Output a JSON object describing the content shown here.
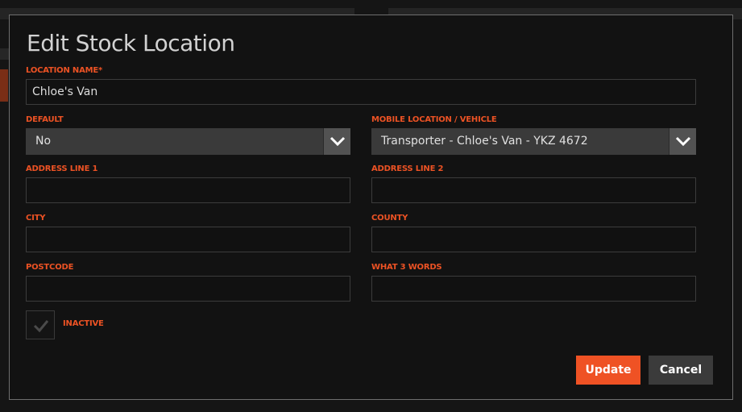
{
  "modal": {
    "title": "Edit Stock Location"
  },
  "fields": {
    "location_name": {
      "label": "LOCATION NAME*",
      "value": "Chloe's Van"
    },
    "default": {
      "label": "DEFAULT",
      "value": "No"
    },
    "mobile_location": {
      "label": "MOBILE LOCATION / VEHICLE",
      "value": "Transporter - Chloe's Van - YKZ 4672"
    },
    "address_line_1": {
      "label": "ADDRESS LINE 1",
      "value": ""
    },
    "address_line_2": {
      "label": "ADDRESS LINE 2",
      "value": ""
    },
    "city": {
      "label": "CITY",
      "value": ""
    },
    "county": {
      "label": "COUNTY",
      "value": ""
    },
    "postcode": {
      "label": "POSTCODE",
      "value": ""
    },
    "what3words": {
      "label": "WHAT 3 WORDS",
      "value": ""
    },
    "inactive": {
      "label": "INACTIVE",
      "checked": false
    }
  },
  "buttons": {
    "update": "Update",
    "cancel": "Cancel"
  },
  "icons": {
    "select_arrow": "chevron-down-icon",
    "checkbox_mark": "checkmark-icon"
  },
  "colors": {
    "accent": "#ef5224",
    "label": "#ec5224",
    "modal_bg": "#121212",
    "select_bg": "#3a3a3a",
    "cancel_bg": "#3b3b3b"
  }
}
